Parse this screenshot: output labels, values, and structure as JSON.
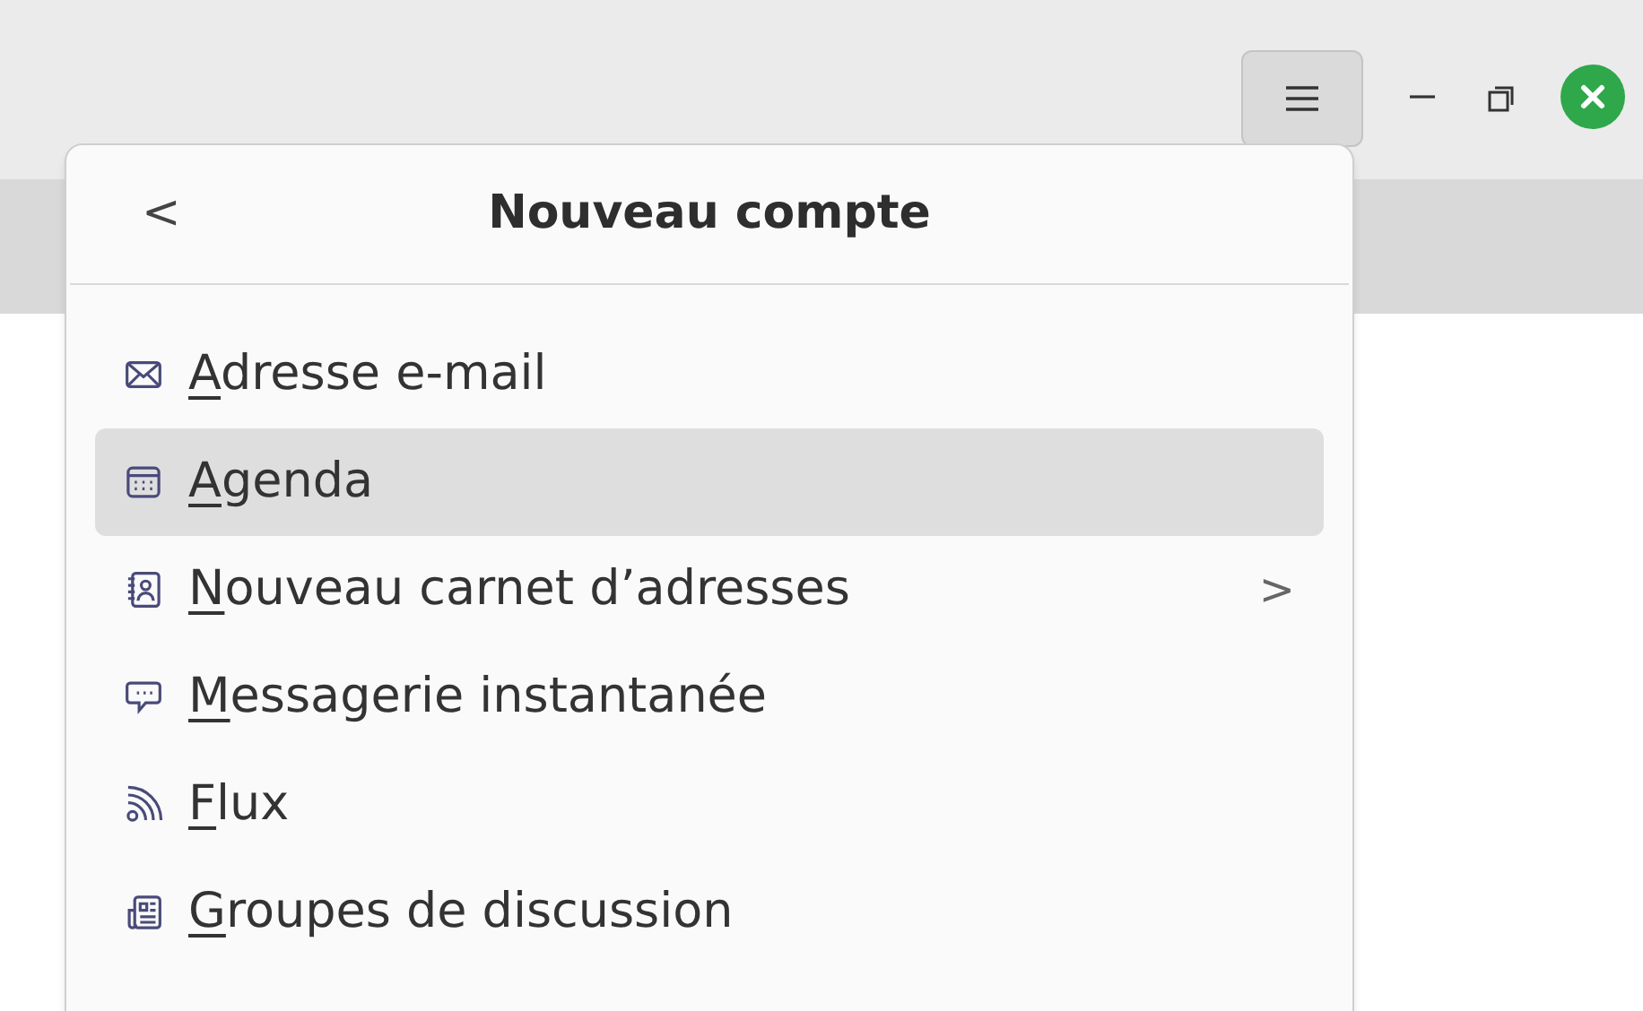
{
  "menu": {
    "title": "Nouveau compte",
    "back": "<",
    "items": [
      {
        "label": "Adresse e-mail",
        "kind": "mail",
        "selected": false
      },
      {
        "label": "Agenda",
        "kind": "calendar",
        "selected": true
      },
      {
        "label": "Nouveau carnet d’adresses",
        "kind": "addressbook",
        "selected": false,
        "arrow": ">"
      },
      {
        "label": "Messagerie instantanée",
        "kind": "chat",
        "selected": false
      },
      {
        "label": "Flux",
        "kind": "feed",
        "selected": false
      },
      {
        "label": "Groupes de discussion",
        "kind": "news",
        "selected": false
      }
    ]
  }
}
